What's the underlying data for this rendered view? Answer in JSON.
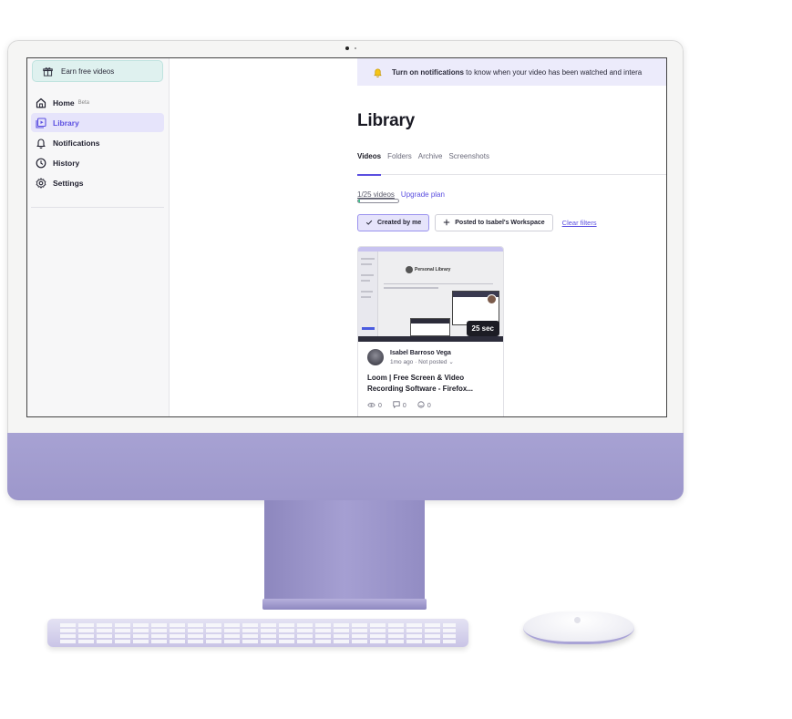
{
  "sidebar": {
    "earn_label": "Earn free videos",
    "nav": [
      {
        "label": "Home",
        "badge": "Beta"
      },
      {
        "label": "Library"
      },
      {
        "label": "Notifications"
      },
      {
        "label": "History"
      },
      {
        "label": "Settings"
      }
    ]
  },
  "banner": {
    "bold": "Turn on notifications",
    "text": " to know when your video has been watched and intera"
  },
  "page_title": "Library",
  "tabs": [
    "Videos",
    "Folders",
    "Archive",
    "Screenshots"
  ],
  "quota": {
    "text": "1/25 videos",
    "upgrade": "Upgrade plan",
    "used_fraction": 0.04
  },
  "filters": {
    "created_by_me": "Created by me",
    "posted_to": "Posted to Isabel's Workspace",
    "clear": "Clear filters"
  },
  "video": {
    "duration": "25 sec",
    "thumb_title": "Personal Library",
    "author": "Isabel Barroso Vega",
    "meta": "1mo ago · Not posted ⌄",
    "title": "Loom | Free Screen & Video Recording Software - Firefox...",
    "views": "0",
    "comments": "0",
    "reactions": "0"
  },
  "colors": {
    "accent": "#5b4fe0",
    "device_purple": "#a7a2d3",
    "earn_bg": "#dff1ef"
  }
}
